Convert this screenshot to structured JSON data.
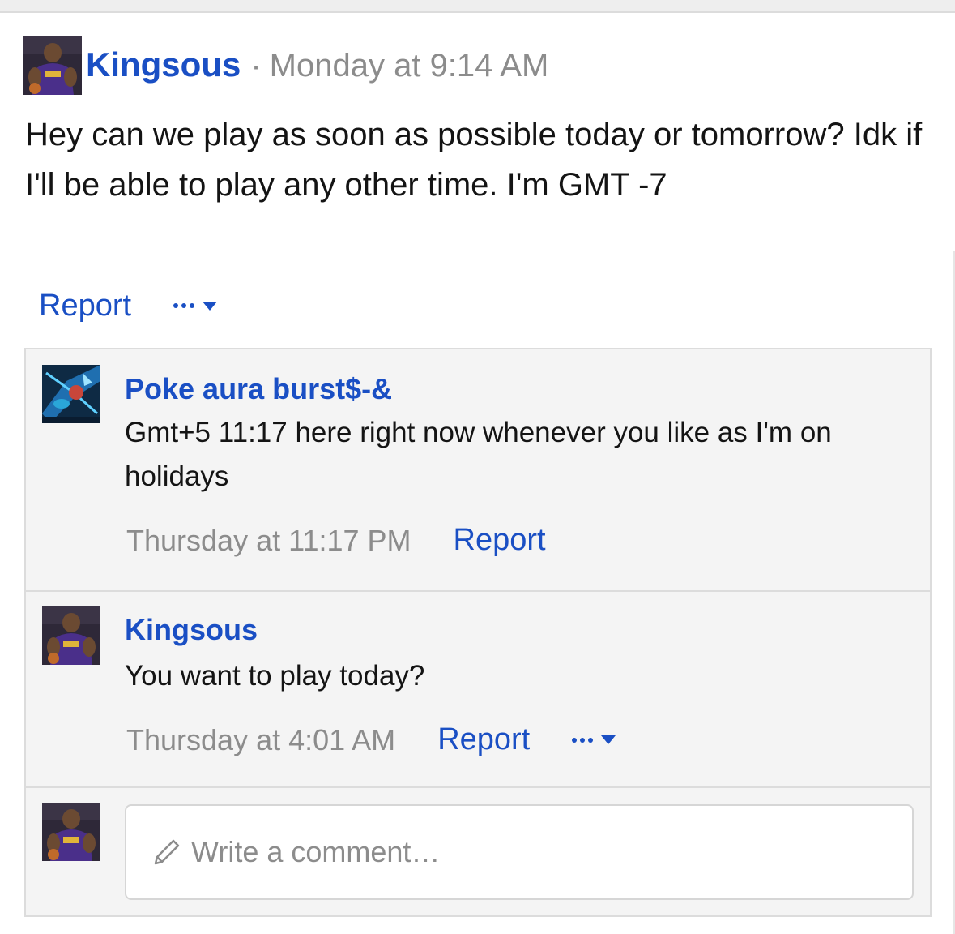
{
  "post": {
    "author": "Kingsous",
    "separator": "·",
    "time": "Monday at 9:14 AM",
    "body": "Hey can we play as soon as possible today or tomorrow? Idk if I'll be able to play any other time. I'm GMT -7",
    "report_label": "Report",
    "more_icon": "ellipsis-caret-icon"
  },
  "comments": [
    {
      "author": "Poke aura burst$-&",
      "text": "Gmt+5 11:17 here right now whenever you like as I'm on holidays",
      "time": "Thursday at 11:17 PM",
      "report_label": "Report"
    },
    {
      "author": "Kingsous",
      "text": "You want to play today?",
      "time": "Thursday at 4:01 AM",
      "report_label": "Report",
      "more_icon": "ellipsis-caret-icon"
    }
  ],
  "comment_input": {
    "placeholder": "Write a comment…",
    "icon": "pencil-icon"
  },
  "colors": {
    "link": "#1a4fc4",
    "muted": "#8c8c8c",
    "thread_bg": "#f4f4f4",
    "border": "#dcdcdc"
  }
}
